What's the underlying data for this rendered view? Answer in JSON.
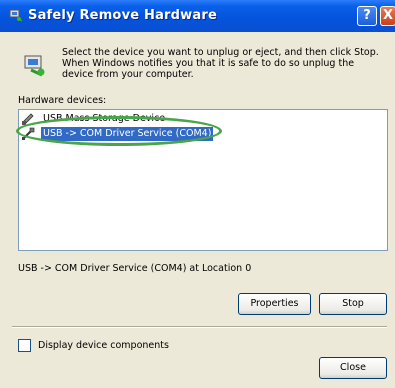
{
  "window": {
    "title": "Safely Remove Hardware",
    "help_label": "?",
    "close_label": "X"
  },
  "intro": {
    "text": "Select the device you want to unplug or eject, and then click Stop. When Windows notifies you that it is safe to do so unplug the device from your computer."
  },
  "hardware": {
    "label": "Hardware devices:",
    "items": [
      {
        "label": "USB Mass Storage Device",
        "icon": "usb-storage-icon",
        "selected": false
      },
      {
        "label": "USB -> COM Driver Service (COM4)",
        "icon": "usb-plug-icon",
        "selected": true
      }
    ],
    "highlight_color": "#4aa54a"
  },
  "status": {
    "text": "USB -> COM Driver Service (COM4) at Location 0"
  },
  "buttons": {
    "properties": "Properties",
    "stop": "Stop",
    "close": "Close"
  },
  "options": {
    "display_components": "Display device components",
    "display_components_checked": false
  },
  "colors": {
    "titlebar": "#0453dc",
    "selection": "#316ac5",
    "window_bg": "#ece9d8"
  }
}
